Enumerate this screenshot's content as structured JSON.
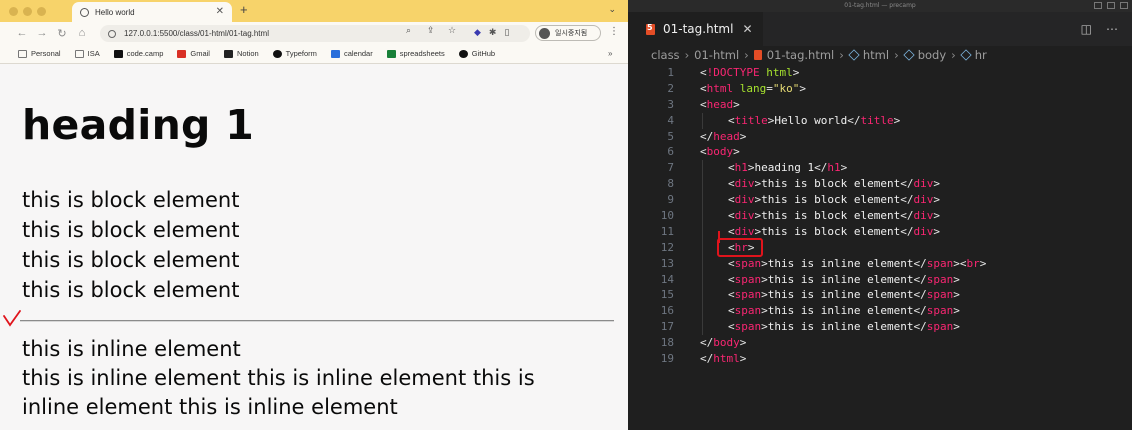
{
  "browser": {
    "tab_title": "Hello world",
    "new_tab_symbol": "+",
    "url": "127.0.0.1:5500/class/01-html/01-tag.html",
    "profile_label": "일시중지됨",
    "bookmarks": [
      {
        "label": "Personal",
        "icon": "folder-icon"
      },
      {
        "label": "ISA",
        "icon": "folder-icon"
      },
      {
        "label": "code.camp",
        "icon": "codecamp-icon"
      },
      {
        "label": "Gmail",
        "icon": "gmail-icon"
      },
      {
        "label": "Notion",
        "icon": "notion-icon"
      },
      {
        "label": "Typeform",
        "icon": "typeform-icon"
      },
      {
        "label": "calendar",
        "icon": "calendar-icon"
      },
      {
        "label": "spreadsheets",
        "icon": "sheets-icon"
      },
      {
        "label": "GitHub",
        "icon": "github-icon"
      }
    ],
    "bookmarks_more": "»"
  },
  "page": {
    "heading": "heading 1",
    "blocks": [
      "this is block element",
      "this is block element",
      "this is block element",
      "this is block element"
    ],
    "inline_first": "this is inline element",
    "inline_rest": "this is inline element this is inline element this is inline element this is inline element"
  },
  "editor": {
    "window_title": "01-tag.html — precamp",
    "tab_label": "01-tag.html",
    "breadcrumb": [
      "class",
      "01-html",
      "01-tag.html",
      "html",
      "body",
      "hr"
    ],
    "lines": [
      {
        "n": "1",
        "tokens": [
          [
            "t-punc",
            "<"
          ],
          [
            "t-doc",
            "!DOCTYPE"
          ],
          [
            "t-attr",
            " html"
          ],
          [
            "t-punc",
            ">"
          ]
        ],
        "indent": 0
      },
      {
        "n": "2",
        "tokens": [
          [
            "t-punc",
            "<"
          ],
          [
            "t-tag",
            "html"
          ],
          [
            "t-attr",
            " lang"
          ],
          [
            "t-punc",
            "="
          ],
          [
            "t-str",
            "\"ko\""
          ],
          [
            "t-punc",
            ">"
          ]
        ],
        "indent": 0
      },
      {
        "n": "3",
        "tokens": [
          [
            "t-punc",
            "<"
          ],
          [
            "t-tag",
            "head"
          ],
          [
            "t-punc",
            ">"
          ]
        ],
        "indent": 0
      },
      {
        "n": "4",
        "tokens": [
          [
            "t-punc",
            "<"
          ],
          [
            "t-tag",
            "title"
          ],
          [
            "t-punc",
            ">"
          ],
          [
            "t-text",
            "Hello world"
          ],
          [
            "t-punc",
            "</"
          ],
          [
            "t-tag",
            "title"
          ],
          [
            "t-punc",
            ">"
          ]
        ],
        "indent": 1
      },
      {
        "n": "5",
        "tokens": [
          [
            "t-punc",
            "</"
          ],
          [
            "t-tag",
            "head"
          ],
          [
            "t-punc",
            ">"
          ]
        ],
        "indent": 0
      },
      {
        "n": "6",
        "tokens": [
          [
            "t-punc",
            "<"
          ],
          [
            "t-tag",
            "body"
          ],
          [
            "t-punc",
            ">"
          ]
        ],
        "indent": 0
      },
      {
        "n": "7",
        "tokens": [
          [
            "t-punc",
            "<"
          ],
          [
            "t-tag",
            "h1"
          ],
          [
            "t-punc",
            ">"
          ],
          [
            "t-text",
            "heading 1"
          ],
          [
            "t-punc",
            "</"
          ],
          [
            "t-tag",
            "h1"
          ],
          [
            "t-punc",
            ">"
          ]
        ],
        "indent": 1
      },
      {
        "n": "8",
        "tokens": [
          [
            "t-punc",
            "<"
          ],
          [
            "t-tag",
            "div"
          ],
          [
            "t-punc",
            ">"
          ],
          [
            "t-text",
            "this is block element"
          ],
          [
            "t-punc",
            "</"
          ],
          [
            "t-tag",
            "div"
          ],
          [
            "t-punc",
            ">"
          ]
        ],
        "indent": 1
      },
      {
        "n": "9",
        "tokens": [
          [
            "t-punc",
            "<"
          ],
          [
            "t-tag",
            "div"
          ],
          [
            "t-punc",
            ">"
          ],
          [
            "t-text",
            "this is block element"
          ],
          [
            "t-punc",
            "</"
          ],
          [
            "t-tag",
            "div"
          ],
          [
            "t-punc",
            ">"
          ]
        ],
        "indent": 1
      },
      {
        "n": "10",
        "tokens": [
          [
            "t-punc",
            "<"
          ],
          [
            "t-tag",
            "div"
          ],
          [
            "t-punc",
            ">"
          ],
          [
            "t-text",
            "this is block element"
          ],
          [
            "t-punc",
            "</"
          ],
          [
            "t-tag",
            "div"
          ],
          [
            "t-punc",
            ">"
          ]
        ],
        "indent": 1
      },
      {
        "n": "11",
        "tokens": [
          [
            "t-punc",
            "<"
          ],
          [
            "t-tag",
            "div"
          ],
          [
            "t-punc",
            ">"
          ],
          [
            "t-text",
            "this is block element"
          ],
          [
            "t-punc",
            "</"
          ],
          [
            "t-tag",
            "div"
          ],
          [
            "t-punc",
            ">"
          ]
        ],
        "indent": 1
      },
      {
        "n": "12",
        "tokens": [
          [
            "t-punc",
            "<"
          ],
          [
            "t-tag",
            "hr"
          ],
          [
            "t-punc",
            ">"
          ]
        ],
        "indent": 1
      },
      {
        "n": "13",
        "tokens": [
          [
            "t-punc",
            "<"
          ],
          [
            "t-tag",
            "span"
          ],
          [
            "t-punc",
            ">"
          ],
          [
            "t-text",
            "this is inline element"
          ],
          [
            "t-punc",
            "</"
          ],
          [
            "t-tag",
            "span"
          ],
          [
            "t-punc",
            "><"
          ],
          [
            "t-tag",
            "br"
          ],
          [
            "t-punc",
            ">"
          ]
        ],
        "indent": 1
      },
      {
        "n": "14",
        "tokens": [
          [
            "t-punc",
            "<"
          ],
          [
            "t-tag",
            "span"
          ],
          [
            "t-punc",
            ">"
          ],
          [
            "t-text",
            "this is inline element"
          ],
          [
            "t-punc",
            "</"
          ],
          [
            "t-tag",
            "span"
          ],
          [
            "t-punc",
            ">"
          ]
        ],
        "indent": 1
      },
      {
        "n": "15",
        "tokens": [
          [
            "t-punc",
            "<"
          ],
          [
            "t-tag",
            "span"
          ],
          [
            "t-punc",
            ">"
          ],
          [
            "t-text",
            "this is inline element"
          ],
          [
            "t-punc",
            "</"
          ],
          [
            "t-tag",
            "span"
          ],
          [
            "t-punc",
            ">"
          ]
        ],
        "indent": 1
      },
      {
        "n": "16",
        "tokens": [
          [
            "t-punc",
            "<"
          ],
          [
            "t-tag",
            "span"
          ],
          [
            "t-punc",
            ">"
          ],
          [
            "t-text",
            "this is inline element"
          ],
          [
            "t-punc",
            "</"
          ],
          [
            "t-tag",
            "span"
          ],
          [
            "t-punc",
            ">"
          ]
        ],
        "indent": 1
      },
      {
        "n": "17",
        "tokens": [
          [
            "t-punc",
            "<"
          ],
          [
            "t-tag",
            "span"
          ],
          [
            "t-punc",
            ">"
          ],
          [
            "t-text",
            "this is inline element"
          ],
          [
            "t-punc",
            "</"
          ],
          [
            "t-tag",
            "span"
          ],
          [
            "t-punc",
            ">"
          ]
        ],
        "indent": 1
      },
      {
        "n": "18",
        "tokens": [
          [
            "t-punc",
            "</"
          ],
          [
            "t-tag",
            "body"
          ],
          [
            "t-punc",
            ">"
          ]
        ],
        "indent": 0
      },
      {
        "n": "19",
        "tokens": [
          [
            "t-punc",
            "</"
          ],
          [
            "t-tag",
            "html"
          ],
          [
            "t-punc",
            ">"
          ]
        ],
        "indent": 0
      }
    ]
  },
  "colors": {
    "chrome_tabbar": "#f7d36a",
    "editor_bg": "#1f1f1f",
    "tag": "#f92672",
    "attr": "#a6e22e",
    "string": "#e6db74",
    "annotation_red": "#e0141c"
  }
}
